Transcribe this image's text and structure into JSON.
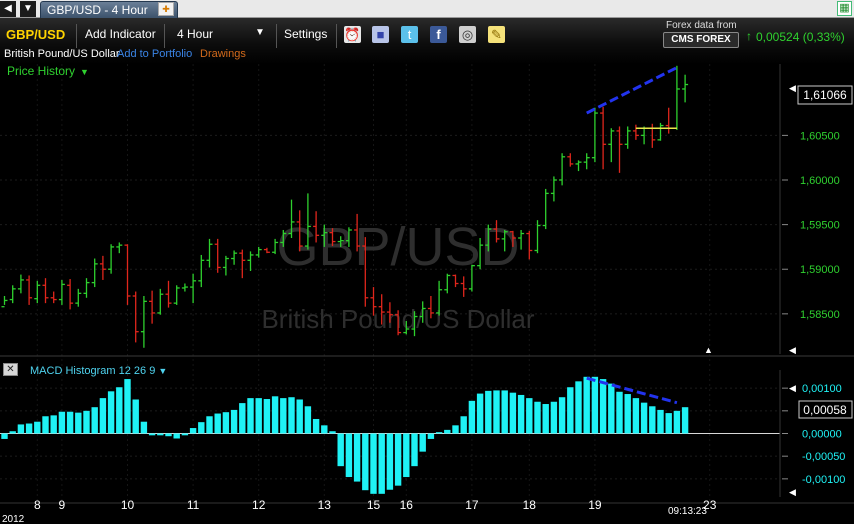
{
  "tabs": {
    "active_label": "GBP/USD - 4 Hour"
  },
  "toolbar": {
    "symbol": "GBP/USD",
    "add_indicator": "Add Indicator",
    "interval": "4 Hour",
    "settings": "Settings",
    "instrument_name": "British Pound/US Dollar",
    "add_to_portfolio": "Add to Portfolio",
    "drawings": "Drawings",
    "data_source_caption": "Forex data from",
    "data_source_logo": "CMS FOREX",
    "change": "0,00524 (0,33%)",
    "colors": {
      "symbol": "#ffd400",
      "portfolio_link": "#3a84e6",
      "drawings_link": "#d36a1b",
      "change": "#2fd12f"
    }
  },
  "price_panel": {
    "label": "Price History",
    "watermark_symbol": "GBP/USD",
    "watermark_name": "British Pound/US Dollar",
    "current_price": "1,61066"
  },
  "macd_panel": {
    "label": "MACD Histogram 12 26 9",
    "current_value": "0,00058"
  },
  "chart_data": [
    {
      "type": "candlestick",
      "title": "GBP/USD",
      "ylim": [
        1.5805,
        1.613
      ],
      "y_ticks": [
        1.585,
        1.59,
        1.595,
        1.6,
        1.605
      ],
      "y_tick_labels": [
        "1,58500",
        "1,59000",
        "1,59500",
        "1,60000",
        "1,60500"
      ],
      "up_color": "#2ed12e",
      "down_color": "#e0261c",
      "bars": [
        [
          1.5858,
          1.587,
          1.586,
          1.5865
        ],
        [
          1.5866,
          1.5882,
          1.5862,
          1.5878
        ],
        [
          1.5878,
          1.5894,
          1.5873,
          1.5888
        ],
        [
          1.5888,
          1.5893,
          1.586,
          1.5868
        ],
        [
          1.5867,
          1.5887,
          1.5862,
          1.5882
        ],
        [
          1.5882,
          1.589,
          1.5862,
          1.5868
        ],
        [
          1.5868,
          1.5875,
          1.5862,
          1.5866
        ],
        [
          1.5866,
          1.5888,
          1.586,
          1.5883
        ],
        [
          1.5882,
          1.5889,
          1.5855,
          1.5862
        ],
        [
          1.5862,
          1.5878,
          1.5858,
          1.5873
        ],
        [
          1.5873,
          1.589,
          1.5868,
          1.5885
        ],
        [
          1.5885,
          1.5912,
          1.588,
          1.5906
        ],
        [
          1.5906,
          1.5915,
          1.5888,
          1.59
        ],
        [
          1.59,
          1.5928,
          1.5895,
          1.5925
        ],
        [
          1.5925,
          1.593,
          1.5918,
          1.5927
        ],
        [
          1.5927,
          1.5928,
          1.586,
          1.587
        ],
        [
          1.587,
          1.5875,
          1.5818,
          1.583
        ],
        [
          1.583,
          1.587,
          1.5812,
          1.5864
        ],
        [
          1.5864,
          1.5876,
          1.5839,
          1.5851
        ],
        [
          1.5851,
          1.5878,
          1.5849,
          1.5872
        ],
        [
          1.5872,
          1.5887,
          1.5857,
          1.5862
        ],
        [
          1.5862,
          1.5882,
          1.586,
          1.5879
        ],
        [
          1.5879,
          1.5884,
          1.5875,
          1.588
        ],
        [
          1.588,
          1.5895,
          1.5862,
          1.5887
        ],
        [
          1.5887,
          1.5916,
          1.588,
          1.591
        ],
        [
          1.591,
          1.5934,
          1.5902,
          1.5928
        ],
        [
          1.5928,
          1.5934,
          1.5896,
          1.5902
        ],
        [
          1.5902,
          1.5915,
          1.5893,
          1.5912
        ],
        [
          1.5912,
          1.5921,
          1.5905,
          1.5918
        ],
        [
          1.5918,
          1.5922,
          1.589,
          1.591
        ],
        [
          1.591,
          1.592,
          1.5898,
          1.5916
        ],
        [
          1.5916,
          1.5925,
          1.5913,
          1.5922
        ],
        [
          1.5922,
          1.5924,
          1.5918,
          1.5919
        ],
        [
          1.5919,
          1.5934,
          1.5917,
          1.593
        ],
        [
          1.593,
          1.5944,
          1.5925,
          1.594
        ],
        [
          1.594,
          1.5978,
          1.5935,
          1.5953
        ],
        [
          1.5953,
          1.5966,
          1.592,
          1.5926
        ],
        [
          1.5926,
          1.5985,
          1.5922,
          1.5948
        ],
        [
          1.5948,
          1.5965,
          1.593,
          1.5938
        ],
        [
          1.5938,
          1.595,
          1.5925,
          1.5941
        ],
        [
          1.5941,
          1.5946,
          1.5926,
          1.5931
        ],
        [
          1.5931,
          1.5937,
          1.5925,
          1.5932
        ],
        [
          1.5932,
          1.5947,
          1.5925,
          1.5944
        ],
        [
          1.5944,
          1.5962,
          1.592,
          1.5926
        ],
        [
          1.5926,
          1.5936,
          1.5858,
          1.5868
        ],
        [
          1.5868,
          1.588,
          1.5848,
          1.5858
        ],
        [
          1.5858,
          1.5872,
          1.5838,
          1.5852
        ],
        [
          1.5852,
          1.5863,
          1.584,
          1.5849
        ],
        [
          1.5849,
          1.5854,
          1.5826,
          1.5829
        ],
        [
          1.5829,
          1.5842,
          1.5827,
          1.5833
        ],
        [
          1.5833,
          1.5853,
          1.5825,
          1.5847
        ],
        [
          1.5847,
          1.5864,
          1.584,
          1.5856
        ],
        [
          1.5856,
          1.587,
          1.5845,
          1.5851
        ],
        [
          1.5851,
          1.5887,
          1.5848,
          1.5877
        ],
        [
          1.5877,
          1.5895,
          1.5873,
          1.5893
        ],
        [
          1.5893,
          1.5894,
          1.588,
          1.5884
        ],
        [
          1.5884,
          1.5892,
          1.5869,
          1.5878
        ],
        [
          1.5878,
          1.5905,
          1.5875,
          1.5904
        ],
        [
          1.5904,
          1.5935,
          1.59,
          1.5927
        ],
        [
          1.5927,
          1.595,
          1.592,
          1.5945
        ],
        [
          1.5945,
          1.5955,
          1.593,
          1.5934
        ],
        [
          1.5934,
          1.5944,
          1.592,
          1.5942
        ],
        [
          1.5942,
          1.5943,
          1.5925,
          1.5935
        ],
        [
          1.5935,
          1.5944,
          1.5922,
          1.594
        ],
        [
          1.594,
          1.5943,
          1.5911,
          1.5921
        ],
        [
          1.5921,
          1.5955,
          1.5918,
          1.5949
        ],
        [
          1.5949,
          1.599,
          1.5945,
          1.5985
        ],
        [
          1.5985,
          1.6004,
          1.5976,
          1.6
        ],
        [
          1.6,
          1.603,
          1.5994,
          1.6026
        ],
        [
          1.6026,
          1.603,
          1.6015,
          1.6018
        ],
        [
          1.6018,
          1.6022,
          1.601,
          1.602
        ],
        [
          1.602,
          1.603,
          1.6012,
          1.6025
        ],
        [
          1.6025,
          1.6081,
          1.602,
          1.6075
        ],
        [
          1.6075,
          1.6082,
          1.6012,
          1.604
        ],
        [
          1.604,
          1.6058,
          1.602,
          1.6055
        ],
        [
          1.6055,
          1.606,
          1.6008,
          1.604
        ],
        [
          1.604,
          1.606,
          1.6035,
          1.6055
        ],
        [
          1.6055,
          1.6062,
          1.6045,
          1.605
        ],
        [
          1.605,
          1.606,
          1.604,
          1.6058
        ],
        [
          1.6058,
          1.6063,
          1.6036,
          1.6045
        ],
        [
          1.6045,
          1.6064,
          1.6044,
          1.6061
        ],
        [
          1.6061,
          1.6081,
          1.6052,
          1.6058
        ],
        [
          1.6058,
          1.6128,
          1.6056,
          1.6102
        ],
        [
          1.6102,
          1.6118,
          1.6087,
          1.6107
        ]
      ],
      "annotations": [
        {
          "type": "trendline",
          "from": [
            71,
            1.6075
          ],
          "to": [
            82,
            1.6126
          ],
          "color": "#2233ee"
        },
        {
          "type": "hline",
          "from": [
            77,
            1.6058
          ],
          "to": [
            82,
            1.6058
          ],
          "color": "#e8e84a"
        }
      ],
      "x_tick_labels": [
        {
          "label": "8",
          "bar": 4
        },
        {
          "label": "9",
          "bar": 7
        },
        {
          "label": "10",
          "bar": 15
        },
        {
          "label": "11",
          "bar": 23
        },
        {
          "label": "12",
          "bar": 31
        },
        {
          "label": "13",
          "bar": 39
        },
        {
          "label": "15",
          "bar": 45
        },
        {
          "label": "16",
          "bar": 49
        },
        {
          "label": "17",
          "bar": 57
        },
        {
          "label": "18",
          "bar": 64
        },
        {
          "label": "19",
          "bar": 72
        },
        {
          "label": "23",
          "bar": 86
        }
      ],
      "year_label": "2012",
      "time_label": "09:13:23"
    },
    {
      "type": "bar",
      "title": "MACD Histogram 12 26 9",
      "ylim": [
        -0.0014,
        0.0014
      ],
      "y_ticks": [
        0.001,
        0.0005,
        0.0,
        -0.0005,
        -0.001
      ],
      "y_tick_labels": [
        "0,00100",
        "0,00050",
        "0,00000",
        "-0,00050",
        "-0,00100"
      ],
      "color": "#1ff2f5",
      "values": [
        -0.00012,
        5e-05,
        0.0002,
        0.00022,
        0.00026,
        0.00038,
        0.0004,
        0.00048,
        0.00048,
        0.00046,
        0.0005,
        0.00058,
        0.00078,
        0.00093,
        0.00102,
        0.0012,
        0.00075,
        0.00026,
        -4e-05,
        -4e-05,
        -6e-05,
        -0.00011,
        -4e-05,
        0.00012,
        0.00025,
        0.00038,
        0.00044,
        0.00047,
        0.00052,
        0.00067,
        0.00078,
        0.00078,
        0.00076,
        0.00082,
        0.00078,
        0.0008,
        0.00075,
        0.0006,
        0.00032,
        0.00018,
        5e-05,
        -0.00072,
        -0.00096,
        -0.00106,
        -0.00125,
        -0.00133,
        -0.00133,
        -0.00124,
        -0.00115,
        -0.00096,
        -0.00072,
        -0.0004,
        -0.00012,
        3e-05,
        8e-05,
        0.00018,
        0.00038,
        0.00072,
        0.00088,
        0.00094,
        0.00095,
        0.00095,
        0.0009,
        0.00085,
        0.00078,
        0.0007,
        0.00065,
        0.0007,
        0.0008,
        0.00102,
        0.00115,
        0.00125,
        0.00125,
        0.0012,
        0.0011,
        0.00092,
        0.00087,
        0.00078,
        0.00068,
        0.0006,
        0.00052,
        0.00045,
        0.0005,
        0.00058
      ],
      "annotations": [
        {
          "type": "trendline",
          "from": [
            71,
            0.00122
          ],
          "to": [
            82,
            0.00068
          ],
          "color": "#2233ee"
        }
      ]
    }
  ]
}
